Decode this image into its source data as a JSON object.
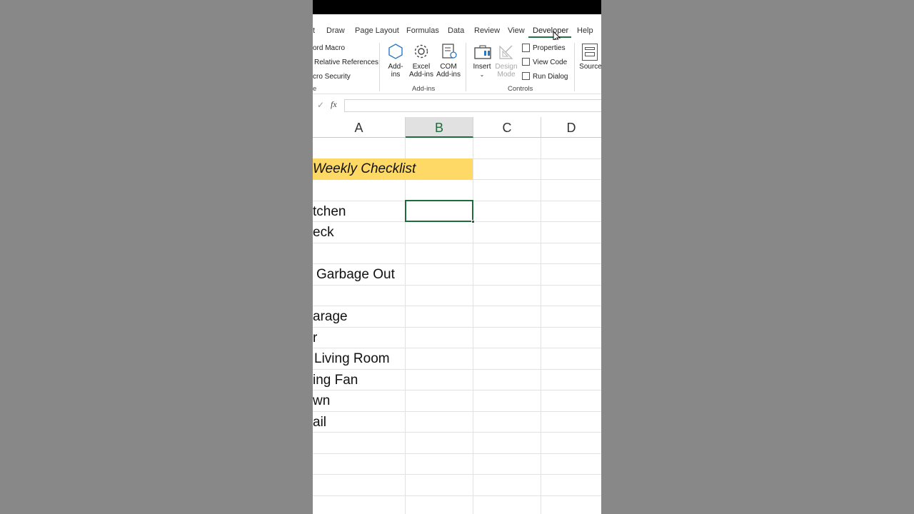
{
  "tabs": [
    {
      "label": "t",
      "active": false
    },
    {
      "label": "Draw",
      "active": false
    },
    {
      "label": "Page Layout",
      "active": false
    },
    {
      "label": "Formulas",
      "active": false
    },
    {
      "label": "Data",
      "active": false
    },
    {
      "label": "Review",
      "active": false
    },
    {
      "label": "View",
      "active": false
    },
    {
      "label": "Developer",
      "active": true
    },
    {
      "label": "Help",
      "active": false
    }
  ],
  "ribbon": {
    "code": {
      "record_macro": "ord Macro",
      "relative_refs": "Relative References",
      "macro_security": "cro Security",
      "group_label": "e"
    },
    "addins": {
      "addins_btn": [
        "Add-",
        "ins"
      ],
      "excel_addins_btn": [
        "Excel",
        "Add-ins"
      ],
      "com_addins_btn": [
        "COM",
        "Add-ins"
      ],
      "group_label": "Add-ins"
    },
    "controls": {
      "insert_btn": "Insert",
      "design_mode_btn": [
        "Design",
        "Mode"
      ],
      "properties": "Properties",
      "view_code": "View Code",
      "run_dialog": "Run Dialog",
      "group_label": "Controls"
    },
    "xml": {
      "source_btn": "Source"
    }
  },
  "formula_bar": {
    "fx_label": "fx",
    "value": ""
  },
  "grid": {
    "columns": [
      "A",
      "B",
      "C",
      "D"
    ],
    "selected_column": "B",
    "title": "Weekly Checklist",
    "title_fill": "#ffd966",
    "rows_a": [
      "",
      "",
      "",
      "tchen",
      "eck",
      "",
      "Garbage Out",
      "",
      "arage",
      "r",
      "Living Room",
      "ing Fan",
      "wn",
      "ail",
      "",
      "",
      "",
      ""
    ]
  },
  "colors": {
    "accent": "#1e6b3c",
    "backdrop": "#888888"
  }
}
